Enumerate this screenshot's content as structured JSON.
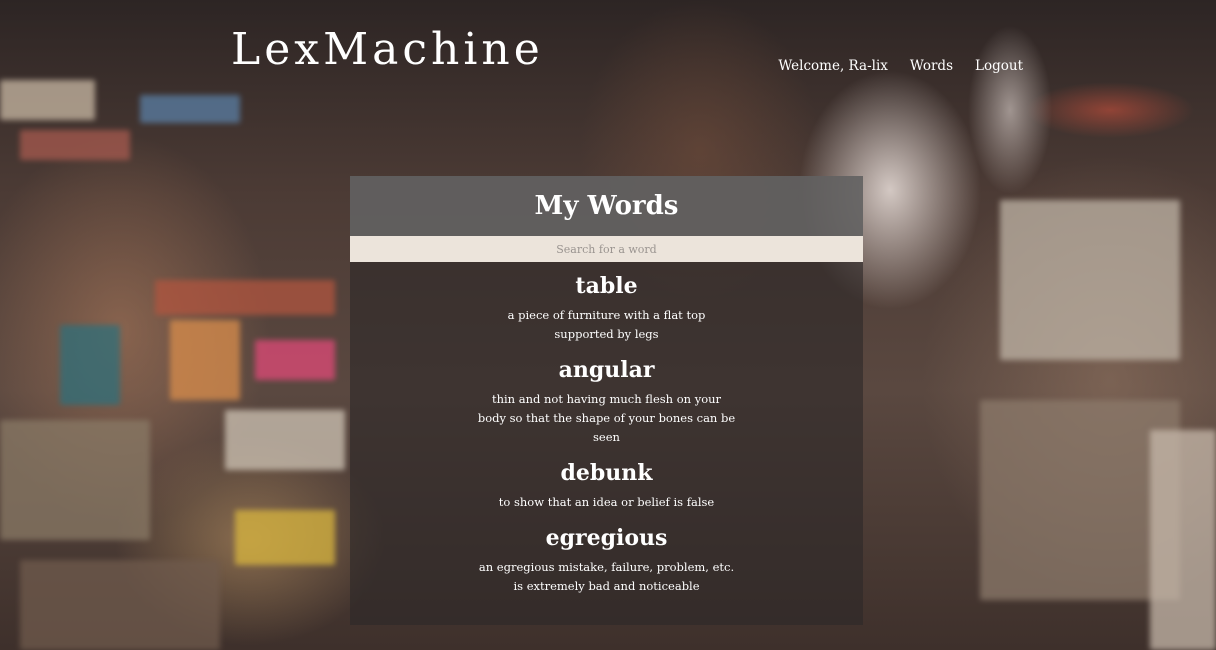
{
  "header": {
    "brand": "LexMachine",
    "nav": {
      "welcome": "Welcome, Ra-lix",
      "words": "Words",
      "logout": "Logout"
    }
  },
  "panel": {
    "title": "My Words",
    "search": {
      "placeholder": "Search for a word",
      "value": ""
    },
    "words": [
      {
        "word": "table",
        "definition": "a piece of furniture with a flat top supported by legs"
      },
      {
        "word": "angular",
        "definition": "thin and not having much flesh on your body so that the shape of your bones can be seen"
      },
      {
        "word": "debunk",
        "definition": "to show that an idea or belief is false"
      },
      {
        "word": "egregious",
        "definition": "an egregious mistake, failure, problem, etc. is extremely bad and noticeable"
      }
    ]
  }
}
